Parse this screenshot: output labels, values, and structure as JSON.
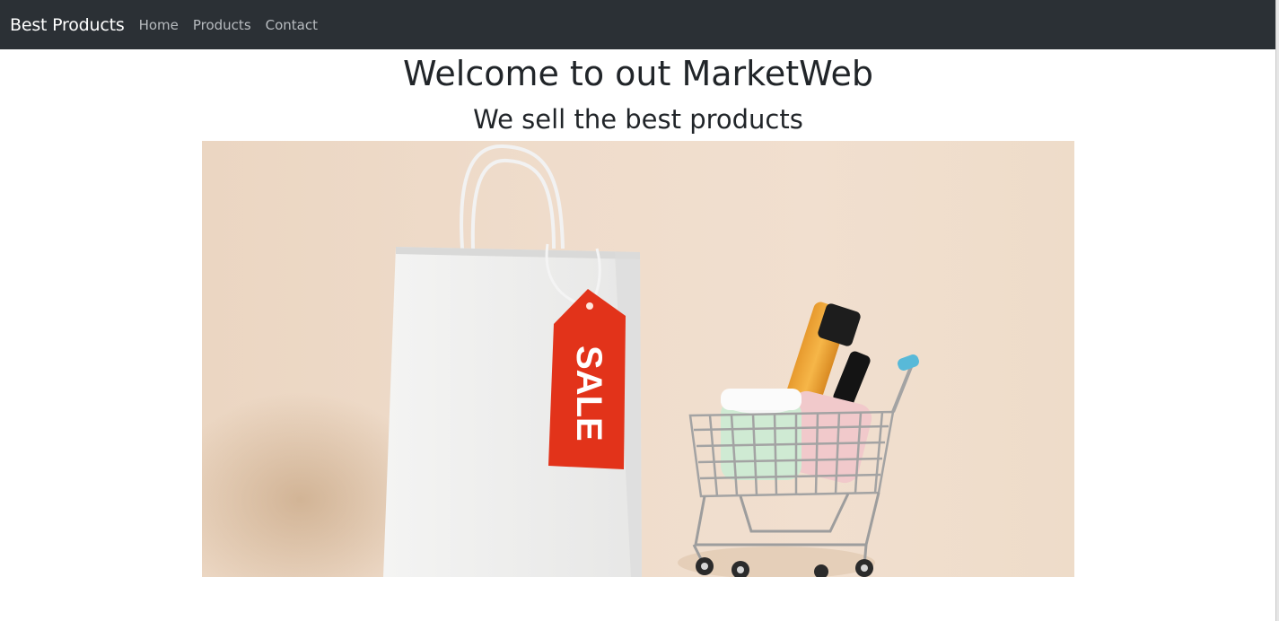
{
  "navbar": {
    "brand": "Best Products",
    "links": [
      {
        "label": "Home"
      },
      {
        "label": "Products"
      },
      {
        "label": "Contact"
      }
    ]
  },
  "main": {
    "title": "Welcome to out MarketWeb",
    "subtitle": "We sell the best products",
    "hero_image": {
      "tag_text": "SALE"
    }
  },
  "colors": {
    "navbar_bg": "#2b3035",
    "tag_red": "#e2331a",
    "background_beige": "#efdccb"
  }
}
